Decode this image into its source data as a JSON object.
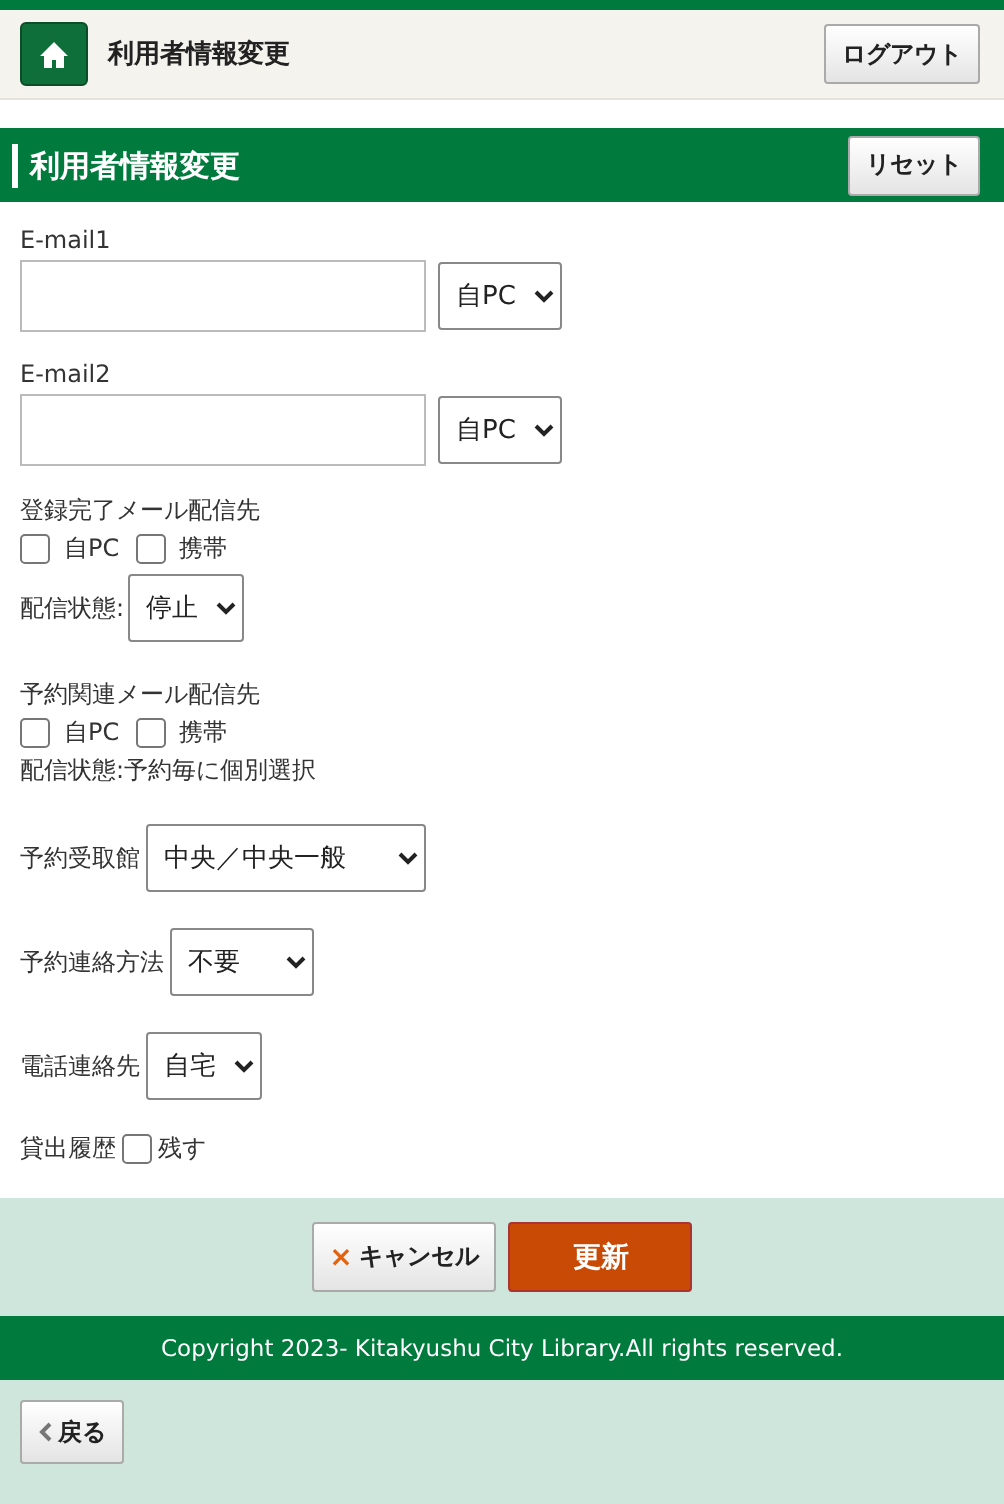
{
  "header": {
    "title": "利用者情報変更",
    "logout": "ログアウト"
  },
  "section": {
    "title": "利用者情報変更",
    "reset": "リセット"
  },
  "emails": [
    {
      "label": "E-mail1",
      "select": "自PC"
    },
    {
      "label": "E-mail2",
      "select": "自PC"
    }
  ],
  "registration_mail": {
    "label": "登録完了メール配信先",
    "options": [
      {
        "label": "自PC",
        "checked": false
      },
      {
        "label": "携帯",
        "checked": false
      }
    ],
    "status_label": "配信状態:",
    "status_select": "停止"
  },
  "reservation_mail": {
    "label": "予約関連メール配信先",
    "options": [
      {
        "label": "自PC",
        "checked": false
      },
      {
        "label": "携帯",
        "checked": false
      }
    ],
    "status_text": "配信状態:予約毎に個別選択"
  },
  "selects": [
    {
      "label": "予約受取館",
      "value": "中央／中央一般"
    },
    {
      "label": "予約連絡方法",
      "value": "不要"
    },
    {
      "label": "電話連絡先",
      "value": "自宅"
    }
  ],
  "history": {
    "label": "貸出履歴",
    "option": "残す",
    "checked": false
  },
  "actions": {
    "cancel_icon": "×",
    "cancel": "キャンセル",
    "submit": "更新"
  },
  "footer": {
    "copyright": "Copyright 2023- Kitakyushu City Library.All rights reserved."
  },
  "back": {
    "label": "戻る"
  }
}
